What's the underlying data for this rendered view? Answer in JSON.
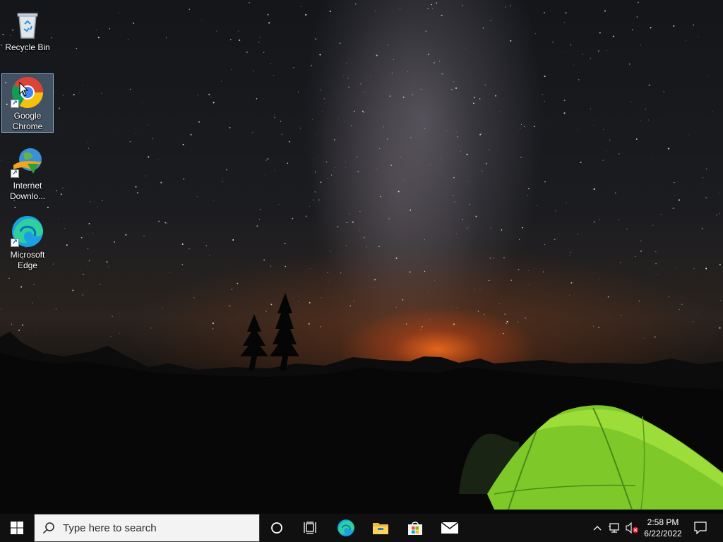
{
  "desktop": {
    "icons": [
      {
        "label": "Recycle Bin",
        "icon": "recycle-bin-icon",
        "selected": false,
        "shortcut": false
      },
      {
        "label": "Google Chrome",
        "icon": "chrome-icon",
        "selected": true,
        "shortcut": true
      },
      {
        "label": "Internet Downlo...",
        "icon": "internet-download-manager-icon",
        "selected": false,
        "shortcut": true
      },
      {
        "label": "Microsoft Edge",
        "icon": "edge-icon",
        "selected": false,
        "shortcut": true
      }
    ],
    "wallpaper": "night sky with milky way, mountains and green tent"
  },
  "taskbar": {
    "start_icon": "windows-logo-icon",
    "search_placeholder": "Type here to search",
    "pinned": [
      {
        "name": "cortana",
        "icon": "cortana-circle-icon"
      },
      {
        "name": "task-view",
        "icon": "task-view-icon"
      },
      {
        "name": "microsoft-edge",
        "icon": "edge-icon"
      },
      {
        "name": "file-explorer",
        "icon": "folder-icon"
      },
      {
        "name": "microsoft-store",
        "icon": "store-bag-icon"
      },
      {
        "name": "mail",
        "icon": "mail-envelope-icon"
      }
    ],
    "tray": {
      "chevron_icon": "chevron-up-icon",
      "network_icon": "network-icon",
      "volume_icon": "volume-muted-icon",
      "time": "2:58 PM",
      "date": "6/22/2022",
      "action_center_icon": "notification-icon"
    }
  },
  "colors": {
    "taskbar_bg": "#101010",
    "search_bg": "#f3f3f3",
    "tent_green": "#8fd630",
    "sunset_orange": "#ff6e1e"
  }
}
